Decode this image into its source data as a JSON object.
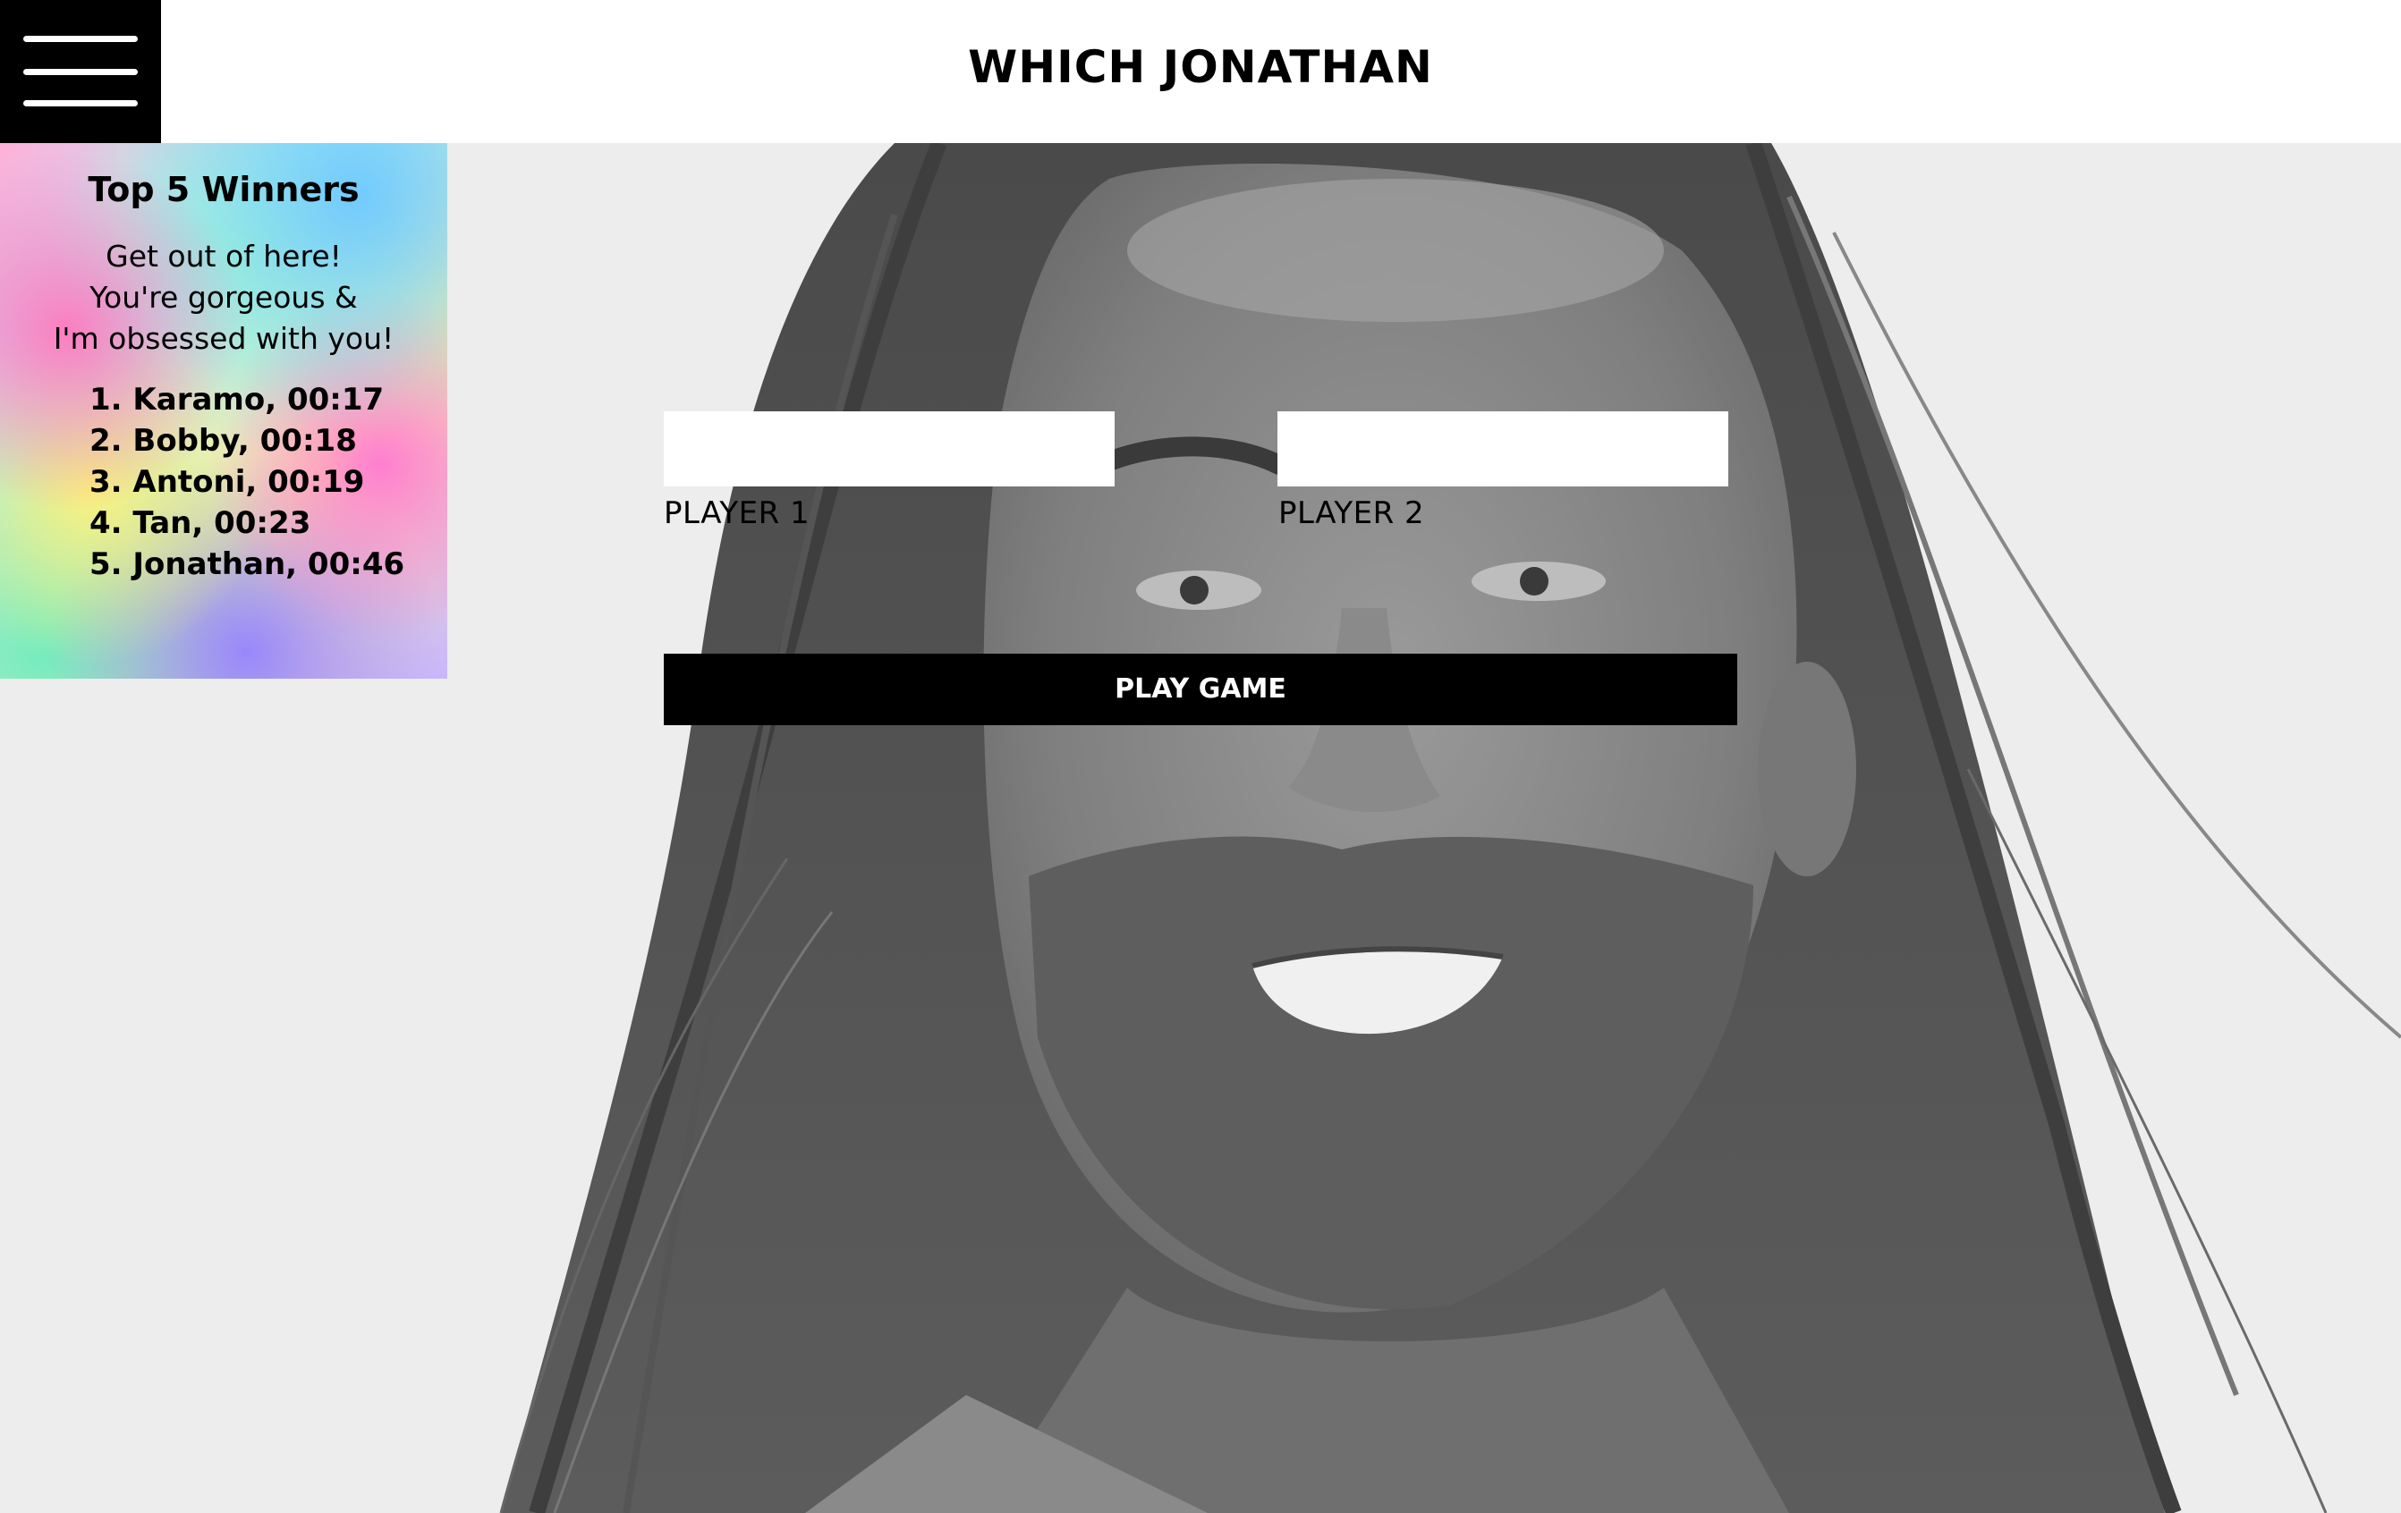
{
  "header": {
    "title": "WHICH JONATHAN",
    "menu_icon": "hamburger-menu-icon"
  },
  "winners": {
    "title": "Top 5 Winners",
    "message_lines": [
      "Get out of here!",
      "You're gorgeous &",
      "I'm obsessed with you!"
    ],
    "entries": [
      "1. Karamo, 00:17",
      "2. Bobby, 00:18",
      "3. Antoni, 00:19",
      "4. Tan, 00:23",
      "5. Jonathan, 00:46"
    ]
  },
  "form": {
    "player1": {
      "value": "",
      "label": "PLAYER 1"
    },
    "player2": {
      "value": "",
      "label": "PLAYER 2"
    },
    "play_label": "PLAY GAME"
  },
  "colors": {
    "header_bg": "#ffffff",
    "menu_bg": "#000000",
    "button_bg": "#000000",
    "button_text": "#ffffff",
    "photo_bg": "#ededed"
  }
}
